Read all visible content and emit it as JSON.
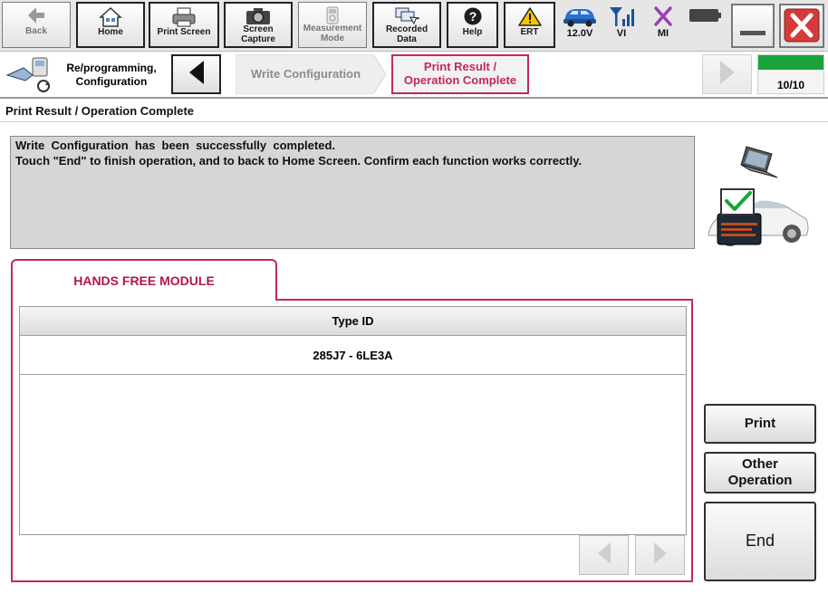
{
  "toolbar": {
    "back": "Back",
    "home": "Home",
    "print_screen": "Print Screen",
    "screen_capture": "Screen\nCapture",
    "measurement_mode": "Measurement\nMode",
    "recorded_data": "Recorded\nData",
    "help": "Help",
    "ert": "ERT",
    "status": {
      "voltage": "12.0V",
      "vi": "VI",
      "mi": "MI"
    }
  },
  "breadcrumb": {
    "section": "Re/programming,\nConfiguration",
    "steps": [
      {
        "label": "Write Configuration",
        "state": "done"
      },
      {
        "label": "Print Result /\nOperation Complete",
        "state": "current"
      }
    ],
    "step_counter": "10/10",
    "progress": 1.0
  },
  "page": {
    "title": "Print Result / Operation Complete",
    "message_line1": "Write  Configuration  has  been  successfully  completed.",
    "message_line2": "Touch \"End\" to finish operation, and to back to Home Screen. Confirm each function works correctly."
  },
  "panel": {
    "tab_label": "HANDS FREE MODULE",
    "table": {
      "header": "Type ID",
      "rows": [
        "285J7 - 6LE3A"
      ]
    }
  },
  "actions": {
    "print": "Print",
    "other_operation": "Other\nOperation",
    "end": "End"
  },
  "colors": {
    "accent": "#c02a5a",
    "progress": "#1aa33a",
    "toolbar_bg": "#e6e6e6",
    "message_bg": "#d6d6d6",
    "close": "#d33b3b"
  },
  "icons": [
    "home-icon",
    "printer-icon",
    "camera-icon",
    "measurement-icon",
    "recorded-data-icon",
    "help-icon",
    "warning-icon",
    "car-icon",
    "signal-icon",
    "mi-icon",
    "battery-icon",
    "close-icon",
    "workflow-icon",
    "chevron-left-icon",
    "chevron-right-icon",
    "check-icon"
  ]
}
